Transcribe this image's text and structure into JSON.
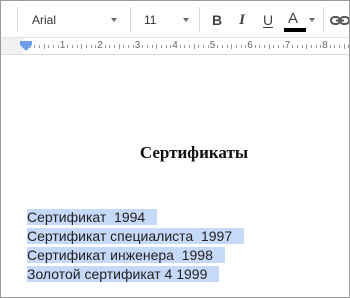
{
  "toolbar": {
    "font_name": "Arial",
    "font_size": "11",
    "bold_label": "B",
    "italic_label": "I",
    "underline_label": "U",
    "text_color_label": "A",
    "text_color_value": "#000000",
    "link_icon": "link-icon"
  },
  "ruler": {
    "numbers": [
      "1",
      "2",
      "3",
      "4",
      "5",
      "6",
      "7",
      "8"
    ]
  },
  "document": {
    "title": "Сертификаты",
    "lines": [
      "Сертификат  1994",
      "Сертификат специалиста  1997",
      "Сертификат инженера  1998",
      "Золотой сертификат 4 1999"
    ],
    "selection_color": "#c6d9f9"
  }
}
